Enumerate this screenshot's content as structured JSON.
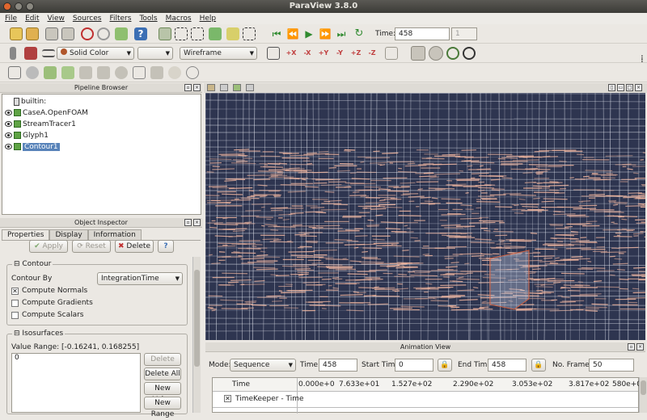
{
  "window": {
    "title": "ParaView 3.8.0"
  },
  "menu": [
    "File",
    "Edit",
    "View",
    "Sources",
    "Filters",
    "Tools",
    "Macros",
    "Help"
  ],
  "toolbar": {
    "time_label": "Time:",
    "time_value": "458",
    "time_index": "1",
    "color_by": "Solid Color",
    "representation": "Wireframe"
  },
  "pipeline": {
    "title": "Pipeline Browser",
    "items": [
      "builtin:",
      "CaseA.OpenFOAM",
      "StreamTracer1",
      "Glyph1",
      "Contour1"
    ]
  },
  "inspector": {
    "title": "Object Inspector",
    "tabs": [
      "Properties",
      "Display",
      "Information"
    ],
    "apply": "Apply",
    "reset": "Reset",
    "delete": "Delete",
    "help": "?",
    "contour_group": "Contour",
    "contour_by_label": "Contour By",
    "contour_by_value": "IntegrationTime",
    "compute_normals": "Compute Normals",
    "compute_gradients": "Compute Gradients",
    "compute_scalars": "Compute Scalars",
    "isosurfaces_group": "Isosurfaces",
    "value_range": "Value Range: [-0.16241, 0.168255]",
    "iso_values": [
      "0"
    ],
    "iso_delete": "Delete",
    "iso_delete_all": "Delete All",
    "iso_new_value": "New Value",
    "iso_new_range": "New Range"
  },
  "animation": {
    "title": "Animation View",
    "mode_label": "Mode:",
    "mode_value": "Sequence",
    "time_label": "Time:",
    "time_value": "458",
    "start_label": "Start Time:",
    "start_value": "0",
    "end_label": "End Time:",
    "end_value": "458",
    "frames_label": "No. Frames:",
    "frames_value": "50",
    "col_time": "Time",
    "ticks": [
      "0.000e+0",
      "7.633e+01",
      "1.527e+02",
      "2.290e+02",
      "3.053e+02",
      "3.817e+02",
      "580e+02"
    ],
    "track": "TimeKeeper - Time"
  },
  "colors": {
    "mesh": "#e6e9f2",
    "particles": "#f2b7a0",
    "background": "#2e3550",
    "selection": "#5883b9"
  }
}
